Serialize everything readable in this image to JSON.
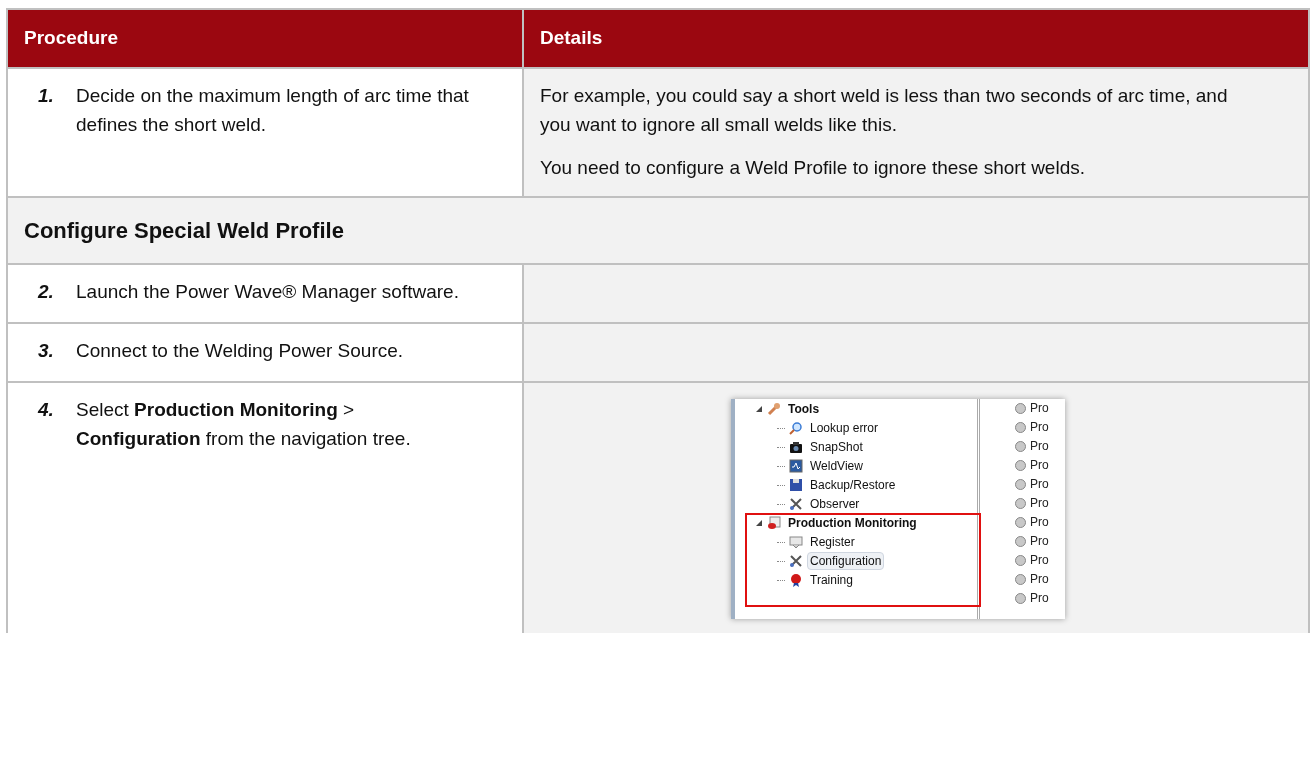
{
  "table": {
    "columns": [
      "Procedure",
      "Details"
    ],
    "rows": [
      {
        "kind": "step",
        "number": "1.",
        "text": "Decide on the maximum length of arc time that defines the short weld.",
        "details": [
          "For example, you could say a short weld is less than two seconds of arc time, and you want to ignore all small welds like this.",
          "You need to configure a Weld Profile to ignore these short welds."
        ]
      },
      {
        "kind": "section",
        "title": "Configure Special Weld Profile"
      },
      {
        "kind": "step",
        "number": "2.",
        "text": "Launch the Power Wave® Manager software.",
        "details": []
      },
      {
        "kind": "step",
        "number": "3.",
        "text": "Connect to the Welding Power Source.",
        "details": []
      },
      {
        "kind": "step",
        "number": "4.",
        "text": "Select **Production Monitoring** > **Configuration** from the navigation tree.",
        "details": [],
        "screenshot": {
          "tree": [
            {
              "label": "Tools",
              "expanded": true,
              "selected": false,
              "children": [
                {
                  "label": "Lookup error",
                  "selected": false
                },
                {
                  "label": "SnapShot",
                  "selected": false
                },
                {
                  "label": "WeldView",
                  "selected": false
                },
                {
                  "label": "Backup/Restore",
                  "selected": false
                },
                {
                  "label": "Observer",
                  "selected": false
                }
              ]
            },
            {
              "label": "Production Monitoring",
              "expanded": true,
              "selected": false,
              "children": [
                {
                  "label": "Register",
                  "selected": false
                },
                {
                  "label": "Configuration",
                  "selected": true
                },
                {
                  "label": "Training",
                  "selected": false
                }
              ]
            }
          ],
          "list": [
            "Pro",
            "Pro",
            "Pro",
            "Pro",
            "Pro",
            "Pro",
            "Pro",
            "Pro",
            "Pro",
            "Pro",
            "Pro"
          ]
        }
      }
    ]
  }
}
